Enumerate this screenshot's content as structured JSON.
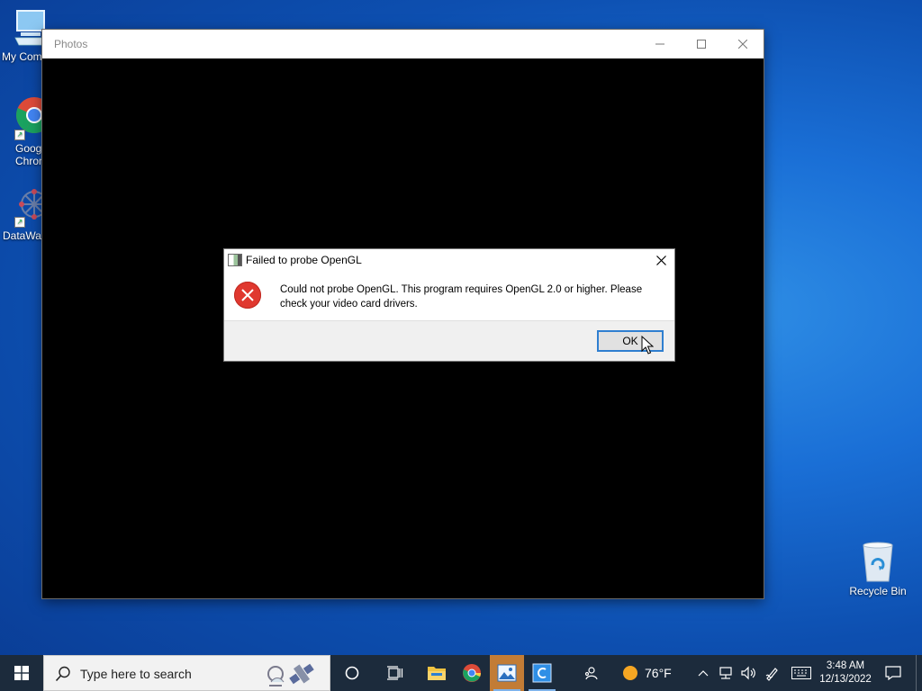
{
  "desktop": {
    "icons": [
      {
        "name": "my-computer-icon",
        "label": "My Com"
      },
      {
        "name": "google-chrome-shortcut",
        "label_line1": "Goog",
        "label_line2": "Chron"
      },
      {
        "name": "datawag-shortcut",
        "label": "DataWag"
      },
      {
        "name": "recycle-bin-icon",
        "label": "Recycle Bin"
      }
    ]
  },
  "photos_window": {
    "title": "Photos"
  },
  "dialog": {
    "title": "Failed to probe OpenGL",
    "message": "Could not probe OpenGL. This program requires OpenGL 2.0 or higher. Please check your video card drivers.",
    "ok_label": "OK"
  },
  "taskbar": {
    "search_placeholder": "Type here to search",
    "weather_temp": "76°F",
    "time": "3:48 AM",
    "date": "12/13/2022"
  },
  "colors": {
    "error_red": "#e0382f",
    "focus_blue": "#2f7fd0",
    "taskbar_bg": "#1c2b3c"
  }
}
